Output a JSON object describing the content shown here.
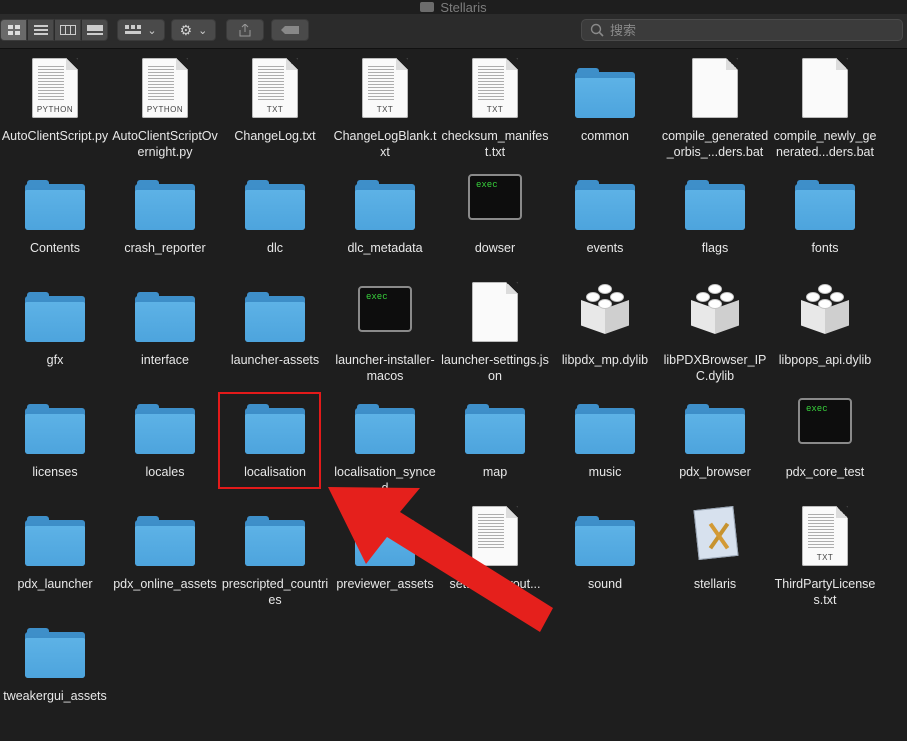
{
  "window": {
    "title": "Stellaris"
  },
  "toolbar": {
    "view_buttons": [
      "icon-view-icon",
      "list-view-icon",
      "column-view-icon",
      "gallery-view-icon"
    ],
    "search_placeholder": "搜索"
  },
  "items": [
    {
      "name": "AutoClientScript.py",
      "kind": "doc",
      "badge": "PYTHON"
    },
    {
      "name": "AutoClientScriptOvernight.py",
      "kind": "doc",
      "badge": "PYTHON"
    },
    {
      "name": "ChangeLog.txt",
      "kind": "doc",
      "badge": "TXT"
    },
    {
      "name": "ChangeLogBlank.txt",
      "kind": "doc",
      "badge": "TXT"
    },
    {
      "name": "checksum_manifest.txt",
      "kind": "doc",
      "badge": "TXT"
    },
    {
      "name": "common",
      "kind": "folder"
    },
    {
      "name": "compile_generated_orbis_...ders.bat",
      "kind": "blank"
    },
    {
      "name": "compile_newly_generated...ders.bat",
      "kind": "blank"
    },
    {
      "name": "Contents",
      "kind": "folder"
    },
    {
      "name": "crash_reporter",
      "kind": "folder"
    },
    {
      "name": "dlc",
      "kind": "folder"
    },
    {
      "name": "dlc_metadata",
      "kind": "folder"
    },
    {
      "name": "dowser",
      "kind": "exec",
      "badge": "exec"
    },
    {
      "name": "events",
      "kind": "folder"
    },
    {
      "name": "flags",
      "kind": "folder"
    },
    {
      "name": "fonts",
      "kind": "folder"
    },
    {
      "name": "gfx",
      "kind": "folder"
    },
    {
      "name": "interface",
      "kind": "folder"
    },
    {
      "name": "launcher-assets",
      "kind": "folder"
    },
    {
      "name": "launcher-installer-macos",
      "kind": "exec",
      "badge": "exec"
    },
    {
      "name": "launcher-settings.json",
      "kind": "blank"
    },
    {
      "name": "libpdx_mp.dylib",
      "kind": "dylib"
    },
    {
      "name": "libPDXBrowser_IPC.dylib",
      "kind": "dylib"
    },
    {
      "name": "libpops_api.dylib",
      "kind": "dylib"
    },
    {
      "name": "licenses",
      "kind": "folder"
    },
    {
      "name": "locales",
      "kind": "folder"
    },
    {
      "name": "localisation",
      "kind": "folder"
    },
    {
      "name": "localisation_synced",
      "kind": "folder"
    },
    {
      "name": "map",
      "kind": "folder"
    },
    {
      "name": "music",
      "kind": "folder"
    },
    {
      "name": "pdx_browser",
      "kind": "folder"
    },
    {
      "name": "pdx_core_test",
      "kind": "exec",
      "badge": "exec"
    },
    {
      "name": "pdx_launcher",
      "kind": "folder"
    },
    {
      "name": "pdx_online_assets",
      "kind": "folder"
    },
    {
      "name": "prescripted_countries",
      "kind": "folder"
    },
    {
      "name": "previewer_assets",
      "kind": "folder"
    },
    {
      "name": "settings-layout...",
      "kind": "doc",
      "badge": ""
    },
    {
      "name": "sound",
      "kind": "folder"
    },
    {
      "name": "stellaris",
      "kind": "app"
    },
    {
      "name": "ThirdPartyLicenses.txt",
      "kind": "doc",
      "badge": "TXT"
    },
    {
      "name": "tweakergui_assets",
      "kind": "folder"
    }
  ],
  "annotation": {
    "highlighted": "localisation",
    "color": "#e31a1a"
  }
}
